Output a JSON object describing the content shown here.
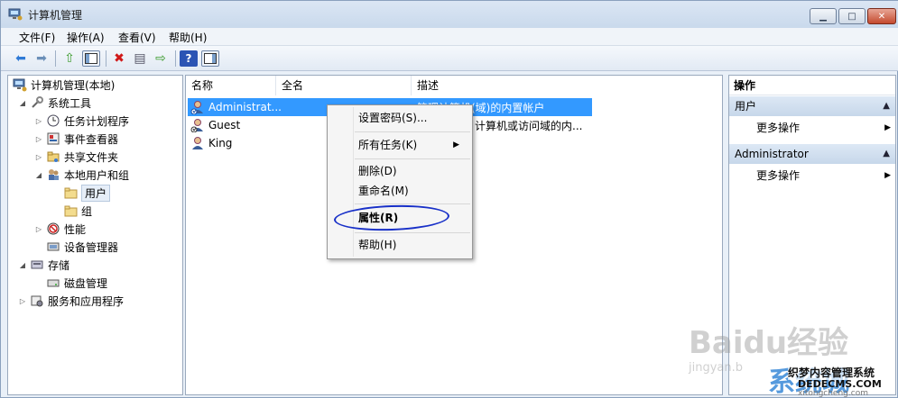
{
  "window": {
    "title": "计算机管理"
  },
  "menu": [
    "文件(F)",
    "操作(A)",
    "查看(V)",
    "帮助(H)"
  ],
  "tree": {
    "root": "计算机管理(本地)",
    "nodes": [
      {
        "label": "系统工具",
        "icon": "tools-icon"
      },
      {
        "label": "任务计划程序",
        "icon": "clock-icon"
      },
      {
        "label": "事件查看器",
        "icon": "event-viewer-icon"
      },
      {
        "label": "共享文件夹",
        "icon": "shared-folder-icon"
      },
      {
        "label": "本地用户和组",
        "icon": "users-group-icon"
      },
      {
        "label": "用户",
        "icon": "folder-icon"
      },
      {
        "label": "组",
        "icon": "folder-icon"
      },
      {
        "label": "性能",
        "icon": "performance-icon"
      },
      {
        "label": "设备管理器",
        "icon": "device-manager-icon"
      },
      {
        "label": "存储",
        "icon": "storage-icon"
      },
      {
        "label": "磁盘管理",
        "icon": "disk-icon"
      },
      {
        "label": "服务和应用程序",
        "icon": "services-icon"
      }
    ]
  },
  "list": {
    "columns": [
      "名称",
      "全名",
      "描述"
    ],
    "rows": [
      {
        "name": "Administrat...",
        "desc": "管理计算机(域)的内置帐户"
      },
      {
        "name": "Guest",
        "desc": "计算机或访问域的内..."
      },
      {
        "name": "King",
        "desc": ""
      }
    ]
  },
  "context_menu": {
    "items": [
      "设置密码(S)...",
      "所有任务(K)",
      "删除(D)",
      "重命名(M)",
      "属性(R)",
      "帮助(H)"
    ]
  },
  "actions": {
    "header": "操作",
    "sections": [
      {
        "title": "用户",
        "item": "更多操作"
      },
      {
        "title": "Administrator",
        "item": "更多操作"
      }
    ]
  },
  "watermark": {
    "baidu": "Baidu经验",
    "jingyan": "jingyan.b",
    "site": "系统城",
    "dede1": "织梦内容管理系统",
    "dede2": "DEDECMS.COM",
    "dede3": "xitongcheng.com"
  },
  "colors": {
    "selection": "#3399ff",
    "circle": "#1830c8"
  }
}
